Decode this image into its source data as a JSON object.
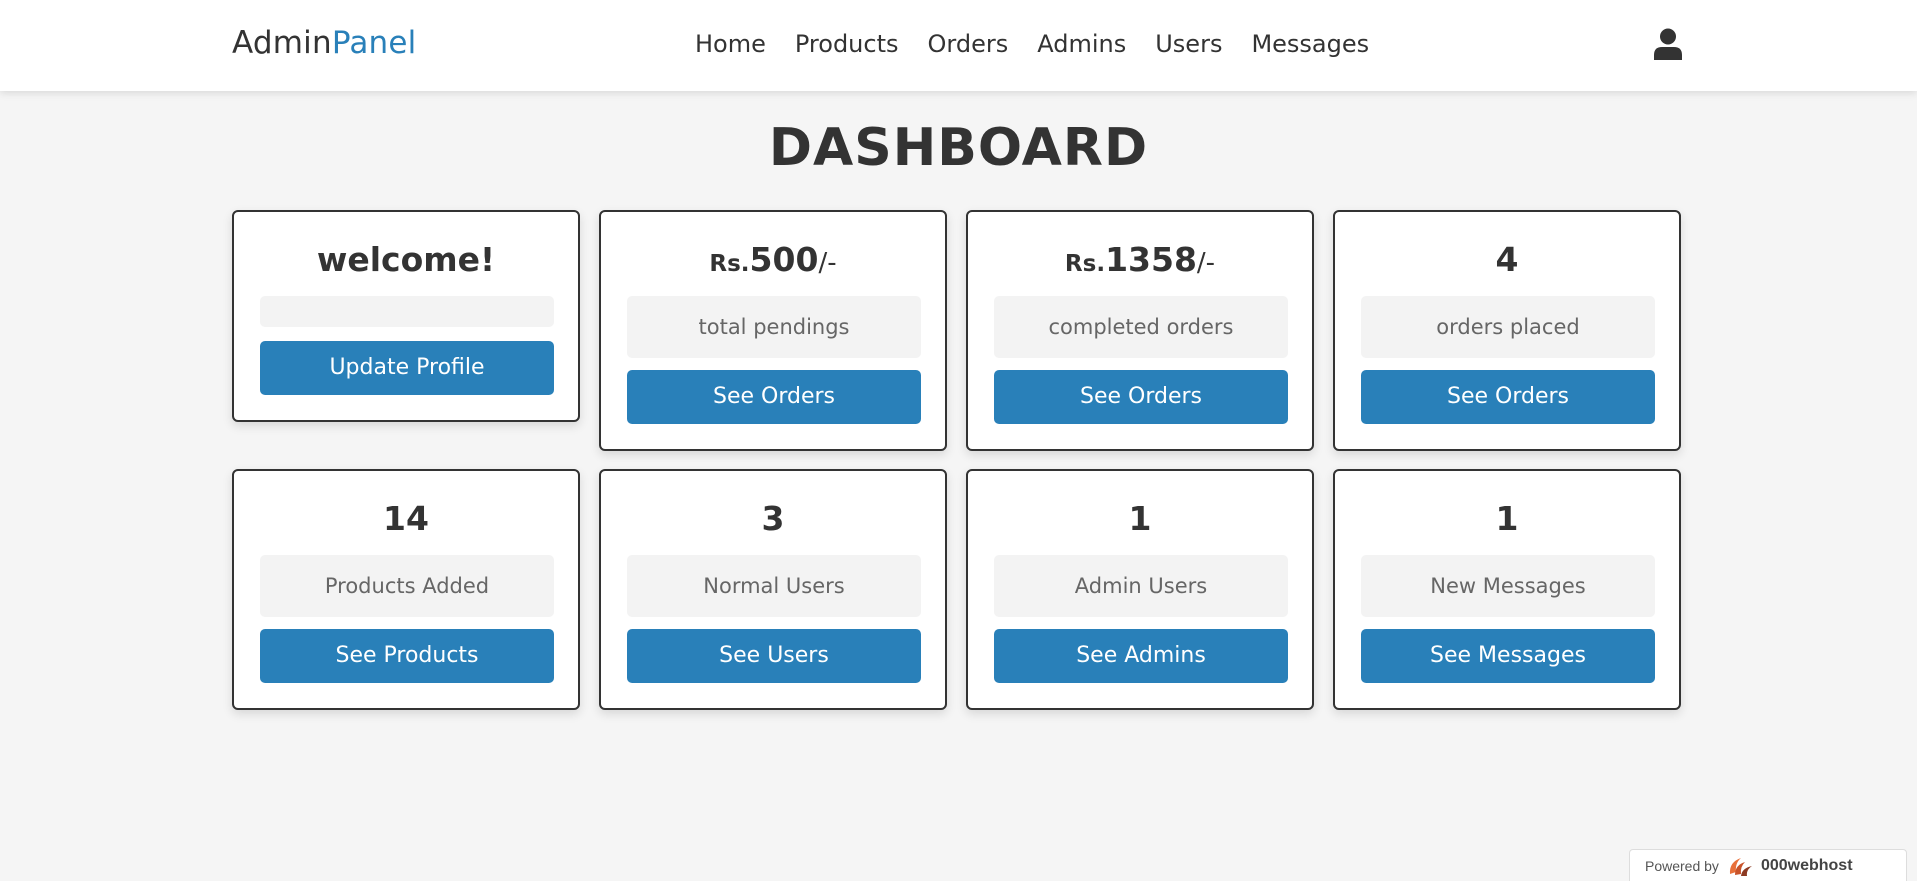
{
  "header": {
    "logo_main": "Admin",
    "logo_accent": "Panel",
    "nav": [
      "Home",
      "Products",
      "Orders",
      "Admins",
      "Users",
      "Messages"
    ],
    "user_icon": "user-icon"
  },
  "page_title": "DASHBOARD",
  "cards": [
    {
      "value": "welcome!",
      "label": "",
      "button": "Update Profile"
    },
    {
      "prefix": "Rs.",
      "value": "500",
      "suffix": "/-",
      "label": "total pendings",
      "button": "See Orders"
    },
    {
      "prefix": "Rs.",
      "value": "1358",
      "suffix": "/-",
      "label": "completed orders",
      "button": "See Orders"
    },
    {
      "value": "4",
      "label": "orders placed",
      "button": "See Orders"
    },
    {
      "value": "14",
      "label": "Products Added",
      "button": "See Products"
    },
    {
      "value": "3",
      "label": "Normal Users",
      "button": "See Users"
    },
    {
      "value": "1",
      "label": "Admin Users",
      "button": "See Admins"
    },
    {
      "value": "1",
      "label": "New Messages",
      "button": "See Messages"
    }
  ],
  "footer": {
    "powered_by": "Powered by",
    "host": "000webhost"
  },
  "colors": {
    "accent": "#2980b9",
    "background": "#f5f5f5",
    "text": "#333333"
  }
}
